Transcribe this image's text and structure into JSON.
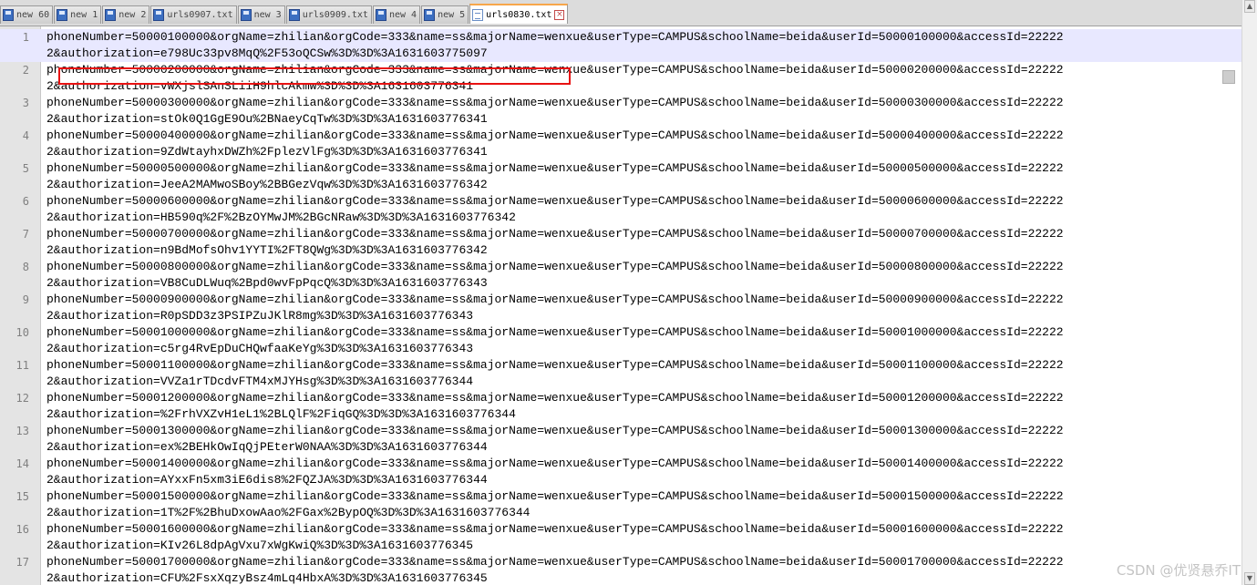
{
  "tabs": [
    {
      "label": "new 60",
      "icon": "blue",
      "active": false
    },
    {
      "label": "new 1",
      "icon": "blue",
      "active": false
    },
    {
      "label": "new 2",
      "icon": "blue",
      "active": false
    },
    {
      "label": "urls0907.txt",
      "icon": "blue",
      "active": false
    },
    {
      "label": "new 3",
      "icon": "blue",
      "active": false
    },
    {
      "label": "urls0909.txt",
      "icon": "blue",
      "active": false
    },
    {
      "label": "new 4",
      "icon": "blue",
      "active": false
    },
    {
      "label": "new 5",
      "icon": "blue",
      "active": false
    },
    {
      "label": "urls0830.txt",
      "icon": "doc",
      "active": true
    }
  ],
  "tab_close_glyph": "×",
  "editor": {
    "lines": [
      {
        "n": "1",
        "a": "phoneNumber=50000100000&orgName=zhilian&orgCode=333&name=ss&majorName=wenxue&userType=CAMPUS&schoolName=beida&userId=50000100000&accessId=22222",
        "b": "2&authorization=e798Uc33pv8MqQ%2F53oQCSw%3D%3D%3A1631603775097"
      },
      {
        "n": "2",
        "a": "phoneNumber=50000200000&orgName=zhilian&orgCode=333&name=ss&majorName=wenxue&userType=CAMPUS&schoolName=beida&userId=50000200000&accessId=22222",
        "b": "2&authorization=vWXjslSAnSLiiH9hlcAkmw%3D%3D%3A1631603776341"
      },
      {
        "n": "3",
        "a": "phoneNumber=50000300000&orgName=zhilian&orgCode=333&name=ss&majorName=wenxue&userType=CAMPUS&schoolName=beida&userId=50000300000&accessId=22222",
        "b": "2&authorization=stOk0Q1GgE9Ou%2BNaeyCqTw%3D%3D%3A1631603776341"
      },
      {
        "n": "4",
        "a": "phoneNumber=50000400000&orgName=zhilian&orgCode=333&name=ss&majorName=wenxue&userType=CAMPUS&schoolName=beida&userId=50000400000&accessId=22222",
        "b": "2&authorization=9ZdWtayhxDWZh%2FplezVlFg%3D%3D%3A1631603776341"
      },
      {
        "n": "5",
        "a": "phoneNumber=50000500000&orgName=zhilian&orgCode=333&name=ss&majorName=wenxue&userType=CAMPUS&schoolName=beida&userId=50000500000&accessId=22222",
        "b": "2&authorization=JeeA2MAMwoSBoy%2BBGezVqw%3D%3D%3A1631603776342"
      },
      {
        "n": "6",
        "a": "phoneNumber=50000600000&orgName=zhilian&orgCode=333&name=ss&majorName=wenxue&userType=CAMPUS&schoolName=beida&userId=50000600000&accessId=22222",
        "b": "2&authorization=HB590q%2F%2BzOYMwJM%2BGcNRaw%3D%3D%3A1631603776342"
      },
      {
        "n": "7",
        "a": "phoneNumber=50000700000&orgName=zhilian&orgCode=333&name=ss&majorName=wenxue&userType=CAMPUS&schoolName=beida&userId=50000700000&accessId=22222",
        "b": "2&authorization=n9BdMofsOhv1YYTI%2FT8QWg%3D%3D%3A1631603776342"
      },
      {
        "n": "8",
        "a": "phoneNumber=50000800000&orgName=zhilian&orgCode=333&name=ss&majorName=wenxue&userType=CAMPUS&schoolName=beida&userId=50000800000&accessId=22222",
        "b": "2&authorization=VB8CuDLWuq%2Bpd0wvFpPqcQ%3D%3D%3A1631603776343"
      },
      {
        "n": "9",
        "a": "phoneNumber=50000900000&orgName=zhilian&orgCode=333&name=ss&majorName=wenxue&userType=CAMPUS&schoolName=beida&userId=50000900000&accessId=22222",
        "b": "2&authorization=R0pSDD3z3PSIPZuJKlR8mg%3D%3D%3A1631603776343"
      },
      {
        "n": "10",
        "a": "phoneNumber=50001000000&orgName=zhilian&orgCode=333&name=ss&majorName=wenxue&userType=CAMPUS&schoolName=beida&userId=50001000000&accessId=22222",
        "b": "2&authorization=c5rg4RvEpDuCHQwfaaKeYg%3D%3D%3A1631603776343"
      },
      {
        "n": "11",
        "a": "phoneNumber=50001100000&orgName=zhilian&orgCode=333&name=ss&majorName=wenxue&userType=CAMPUS&schoolName=beida&userId=50001100000&accessId=22222",
        "b": "2&authorization=VVZa1rTDcdvFTM4xMJYHsg%3D%3D%3A1631603776344"
      },
      {
        "n": "12",
        "a": "phoneNumber=50001200000&orgName=zhilian&orgCode=333&name=ss&majorName=wenxue&userType=CAMPUS&schoolName=beida&userId=50001200000&accessId=22222",
        "b": "2&authorization=%2FrhVXZvH1eL1%2BLQlF%2FiqGQ%3D%3D%3A1631603776344"
      },
      {
        "n": "13",
        "a": "phoneNumber=50001300000&orgName=zhilian&orgCode=333&name=ss&majorName=wenxue&userType=CAMPUS&schoolName=beida&userId=50001300000&accessId=22222",
        "b": "2&authorization=ex%2BEHkOwIqQjPEterW0NAA%3D%3D%3A1631603776344"
      },
      {
        "n": "14",
        "a": "phoneNumber=50001400000&orgName=zhilian&orgCode=333&name=ss&majorName=wenxue&userType=CAMPUS&schoolName=beida&userId=50001400000&accessId=22222",
        "b": "2&authorization=AYxxFn5xm3iE6dis8%2FQZJA%3D%3D%3A1631603776344"
      },
      {
        "n": "15",
        "a": "phoneNumber=50001500000&orgName=zhilian&orgCode=333&name=ss&majorName=wenxue&userType=CAMPUS&schoolName=beida&userId=50001500000&accessId=22222",
        "b": "2&authorization=1T%2F%2BhuDxowAao%2FGax%2BypOQ%3D%3D%3A1631603776344"
      },
      {
        "n": "16",
        "a": "phoneNumber=50001600000&orgName=zhilian&orgCode=333&name=ss&majorName=wenxue&userType=CAMPUS&schoolName=beida&userId=50001600000&accessId=22222",
        "b": "2&authorization=KIv26L8dpAgVxu7xWgKwiQ%3D%3D%3A1631603776345"
      },
      {
        "n": "17",
        "a": "phoneNumber=50001700000&orgName=zhilian&orgCode=333&name=ss&majorName=wenxue&userType=CAMPUS&schoolName=beida&userId=50001700000&accessId=22222",
        "b": "2&authorization=CFU%2FsxXqzyBsz4mLq4HbxA%3D%3D%3A1631603776345"
      }
    ]
  },
  "scrollbar": {
    "up_glyph": "▲",
    "down_glyph": "▼"
  },
  "watermark": "CSDN @优贤悬乔IT",
  "colors": {
    "highlight_box": "#e81212",
    "active_tab_accent": "#f7a64a",
    "current_line": "#e8e8ff"
  }
}
